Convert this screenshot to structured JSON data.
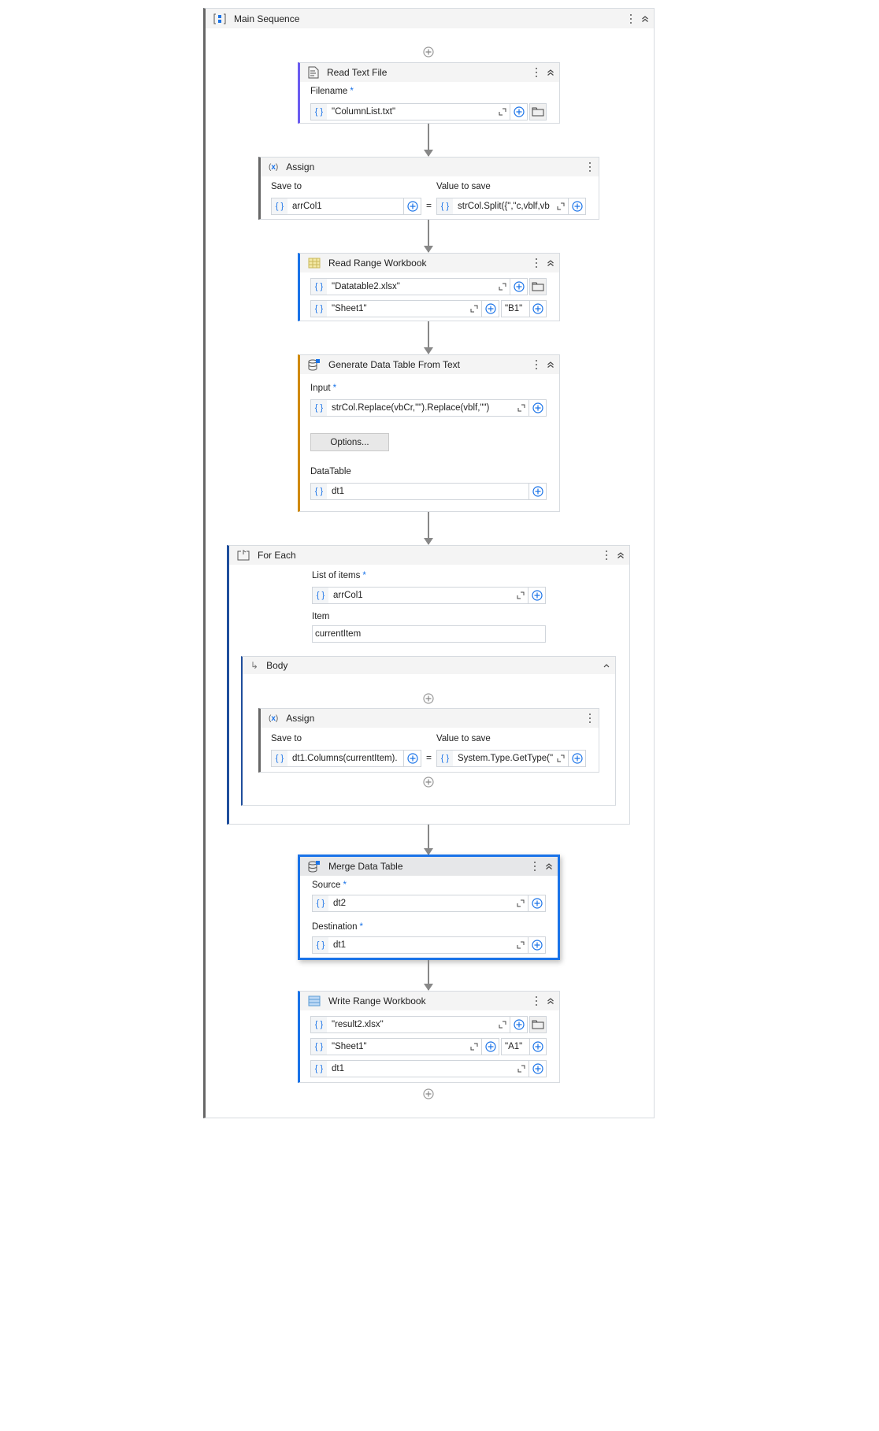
{
  "main": {
    "title": "Main Sequence"
  },
  "read_text_file": {
    "title": "Read Text File",
    "filename_label": "Filename",
    "required": "*",
    "filename": "\"ColumnList.txt\""
  },
  "assign1": {
    "title": "Assign",
    "save_to_label": "Save to",
    "value_label": "Value to save",
    "save_to": "arrCol1",
    "equals": "=",
    "value": "strCol.Split({\",\"c,vblf,vb"
  },
  "read_range": {
    "title": "Read Range Workbook",
    "workbook": "\"Datatable2.xlsx\"",
    "sheet": "\"Sheet1\"",
    "range": "\"B1\""
  },
  "generate": {
    "title": "Generate Data Table From Text",
    "input_label": "Input",
    "required": "*",
    "input": "strCol.Replace(vbCr,\"\").Replace(vblf,\"\")",
    "options_label": "Options...",
    "datatable_label": "DataTable",
    "datatable": "dt1"
  },
  "for_each": {
    "title": "For Each",
    "list_label": "List of items",
    "required": "*",
    "list": "arrCol1",
    "item_label": "Item",
    "item": "currentItem",
    "body_title": "Body"
  },
  "assign2": {
    "title": "Assign",
    "save_to_label": "Save to",
    "value_label": "Value to save",
    "save_to": "dt1.Columns(currentItem).",
    "equals": "=",
    "value": "System.Type.GetType(\""
  },
  "merge": {
    "title": "Merge Data Table",
    "source_label": "Source",
    "required": "*",
    "source": "dt2",
    "destination_label": "Destination",
    "destination": "dt1"
  },
  "write_range": {
    "title": "Write Range Workbook",
    "workbook": "\"result2.xlsx\"",
    "sheet": "\"Sheet1\"",
    "start_cell": "\"A1\"",
    "datatable": "dt1"
  },
  "colors": {
    "accent_blue": "#1a73e8",
    "foreach_blue": "#1f4e9c",
    "generate_orange": "#d08a00",
    "readtext_purple": "#6b5cf0"
  }
}
